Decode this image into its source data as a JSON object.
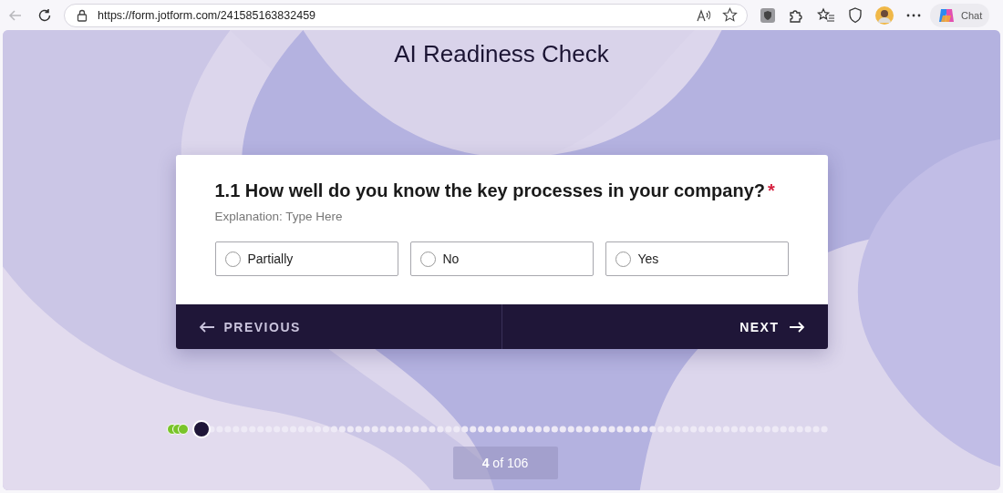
{
  "browser": {
    "url": "https://form.jotform.com/241585163832459",
    "chat_label": "Chat"
  },
  "form": {
    "title": "AI Readiness Check",
    "question": {
      "text": "1.1 How well do you know the key processes in your company?",
      "required_mark": "*",
      "description": "Explanation: Type Here",
      "options": [
        {
          "label": "Partially",
          "selected": false
        },
        {
          "label": "No",
          "selected": false
        },
        {
          "label": "Yes",
          "selected": false
        }
      ]
    },
    "previous_label": "PREVIOUS",
    "next_label": "NEXT",
    "progress": {
      "counter": "**4** of 106"
    }
  }
}
